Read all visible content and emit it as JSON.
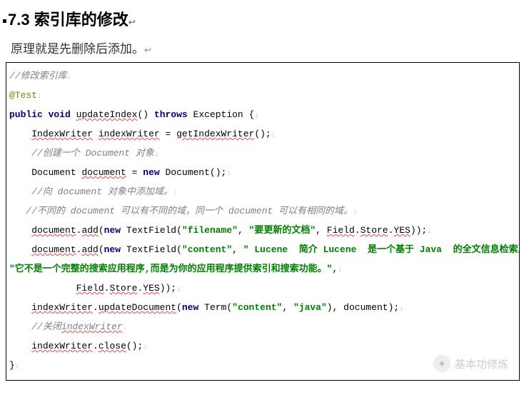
{
  "heading": "7.3  索引库的修改",
  "intro": "原理就是先删除后添加。",
  "code": {
    "c1": "//修改索引库",
    "c2": "@Test",
    "kw_public": "public",
    "kw_void": "void",
    "m_update": "updateIndex",
    "kw_throws": "throws",
    "t_exc": "Exception",
    "l3_open": "() ",
    "l3_close": " {",
    "t_iw": "IndexWriter",
    "v_iw": "indexWriter",
    "eq": " = ",
    "m_get": "getIndexWriter",
    "l4_tail": "();",
    "c5": "//创建一个 Document 对象",
    "t_doc": "Document",
    "v_doc": "document",
    "kw_new": "new",
    "l6_tail": "();",
    "c7": "//向 document 对象中添加域。",
    "c8": "//不同的 document 可以有不同的域，同一个 document 可以有相同的域。",
    "l9_doc": "document",
    "l9_add": "add",
    "l9_tf": "TextField",
    "s_filename": "\"filename\"",
    "s_doctitle": "\"要更新的文档\"",
    "l9_field": "Field",
    "l9_store": "Store",
    "l9_yes": "YES",
    "l10_doc": "document",
    "l10_add": "add",
    "l10_tf": "TextField",
    "s_content": "\"content\"",
    "s_big": "\" Lucene  简介 Lucene  是一个基于 Java  的全文信息检索工具包,\"",
    "plus": " +",
    "s_big2": "\"它不是一个完整的搜索应用程序,而是为你的应用程序提供索引和搜索功能。\"",
    "comma": ",",
    "l12_field": "Field",
    "l12_store": "Store",
    "l12_yes": "YES",
    "l12_tail": "));",
    "l13_iw": "indexWriter",
    "l13_upd": "updateDocument",
    "l13_term": "Term",
    "s_content2": "\"content\"",
    "s_java": "\"java\"",
    "l13_tail": "), document);",
    "c14": "//关闭",
    "c14b": "indexWriter",
    "l15_iw": "indexWriter",
    "l15_close": "close",
    "l15_tail": "();",
    "l16": "}"
  },
  "watermark": "基本功修炼"
}
